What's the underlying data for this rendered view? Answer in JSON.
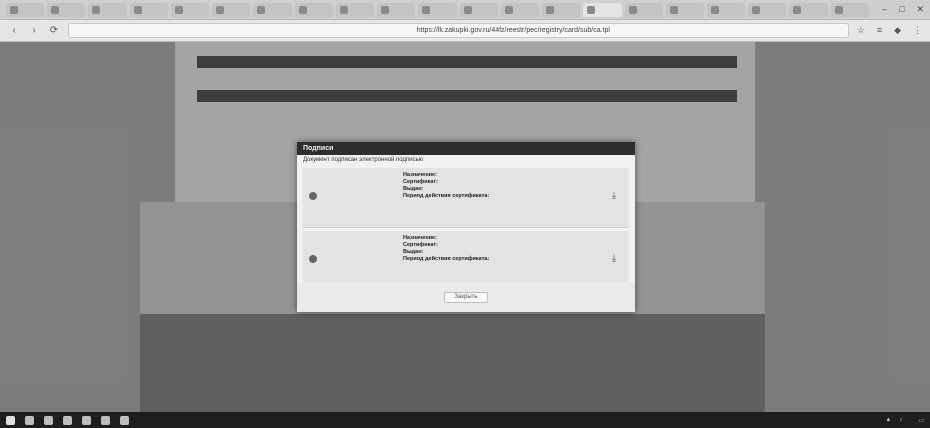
{
  "browser": {
    "tabs": [
      "",
      "",
      "",
      "",
      "",
      "",
      "",
      "",
      "",
      "",
      "",
      "",
      "",
      "",
      "",
      "",
      "",
      "",
      "",
      "",
      ""
    ],
    "address": {
      "tab_label": "",
      "url": "https://lk.zakupki.gov.ru/44fz/reestr/pec/registry/card/sub/ca.tpl",
      "zoom": ""
    }
  },
  "modal": {
    "title": "Подписи",
    "subtitle": "Документ подписан электронной подписью",
    "rows": [
      {
        "date": "",
        "owner_label": "Назначение:",
        "owner_value": "",
        "cert_label": "Сертификат:",
        "cert_value": "",
        "issuer_label": "Выдан:",
        "issuer_value": "",
        "validity_label": "Период действия сертификата:",
        "validity_value": "",
        "extra": ""
      },
      {
        "date": "",
        "owner_label": "Назначение:",
        "owner_value": "",
        "cert_label": "Сертификат:",
        "cert_value": "",
        "issuer_label": "Выдан:",
        "issuer_value": "",
        "validity_label": "Период действия сертификата:",
        "validity_value": "",
        "extra": ""
      }
    ],
    "close_label": "Закрыть"
  },
  "taskbar": {
    "time": "",
    "date": ""
  },
  "icons": {
    "back": "back-arrow-icon",
    "forward": "forward-arrow-icon",
    "reload": "reload-icon",
    "download": "download-icon"
  }
}
